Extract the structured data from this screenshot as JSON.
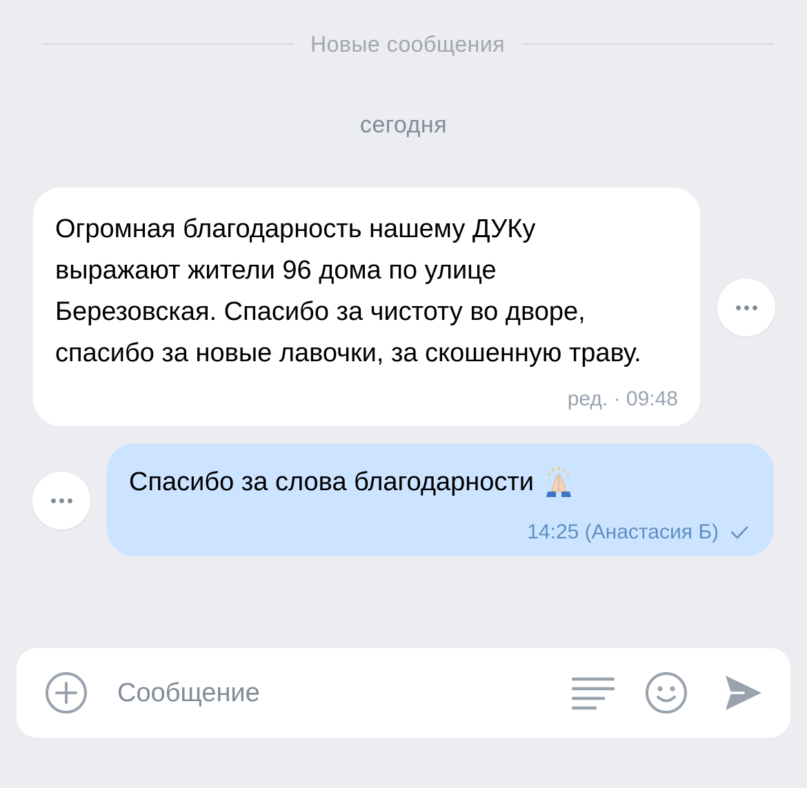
{
  "divider": {
    "label": "Новые сообщения"
  },
  "date_label": "сегодня",
  "messages": [
    {
      "direction": "incoming",
      "text": "Огромная благодарность нашему ДУКу выражают жители 96 дома по улице Березовская. Спасибо за чистоту во дворе, спасибо за новые лавочки, за скошенную траву.",
      "meta": "ред. · 09:48"
    },
    {
      "direction": "outgoing",
      "text": "Спасибо за слова благодарности",
      "emoji": "folded-hands-icon",
      "meta": "14:25 (Анастасия Б)",
      "status_icon": "check-icon"
    }
  ],
  "composer": {
    "placeholder": "Сообщение",
    "value": "",
    "icons": [
      "plus-circle-icon",
      "template-lines-icon",
      "smile-icon",
      "send-icon"
    ]
  },
  "colors": {
    "background": "#ebedf0",
    "incoming_bubble": "#ffffff",
    "outgoing_bubble": "#cce4ff",
    "secondary_text": "#818c99",
    "outgoing_meta": "#5e8fc2",
    "icon": "#99a2ad"
  }
}
